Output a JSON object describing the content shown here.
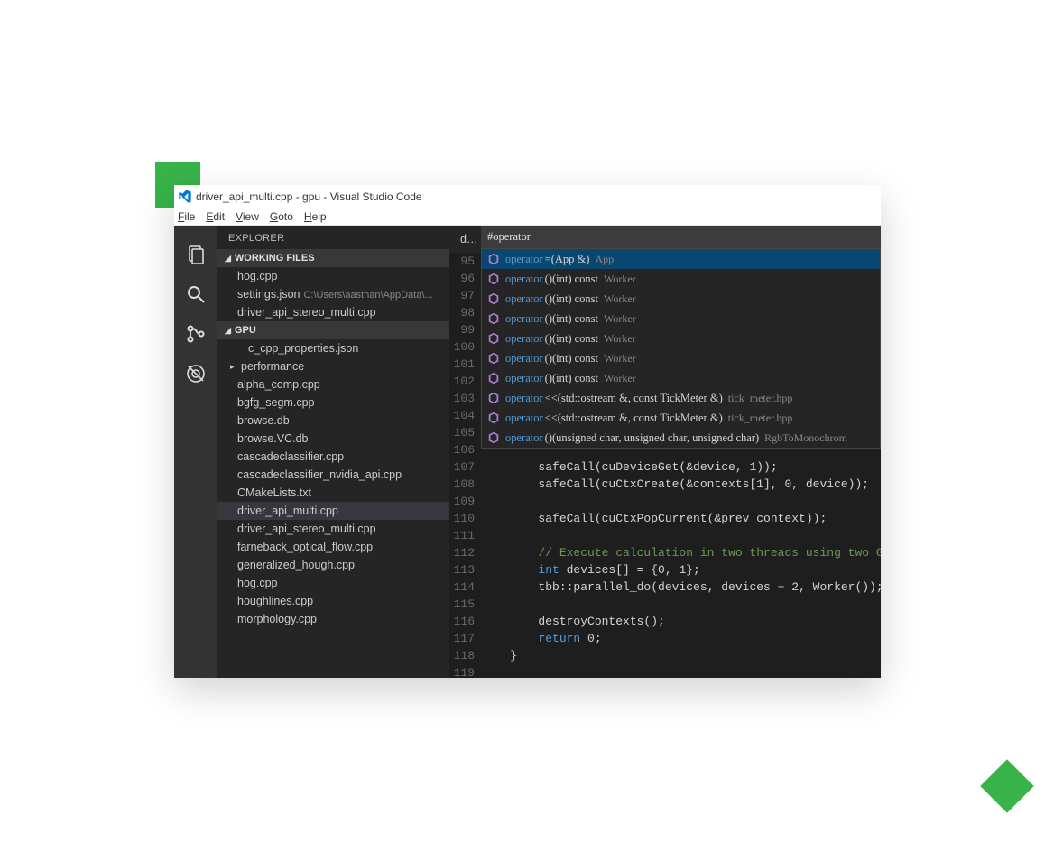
{
  "window": {
    "title": "driver_api_multi.cpp - gpu - Visual Studio Code"
  },
  "menu": {
    "file": "File",
    "edit": "Edit",
    "view": "View",
    "goto": "Goto",
    "help": "Help"
  },
  "sidebar": {
    "title": "EXPLORER",
    "working_header": "WORKING FILES",
    "working": [
      {
        "name": "hog.cpp"
      },
      {
        "name": "settings.json",
        "dim": "C:\\Users\\aasthan\\AppData\\..."
      },
      {
        "name": "driver_api_stereo_multi.cpp"
      }
    ],
    "project_header": "GPU",
    "files": [
      {
        "name": "c_cpp_properties.json",
        "indent": true
      },
      {
        "name": "performance",
        "tw": "▸"
      },
      {
        "name": "alpha_comp.cpp"
      },
      {
        "name": "bgfg_segm.cpp"
      },
      {
        "name": "browse.db"
      },
      {
        "name": "browse.VC.db"
      },
      {
        "name": "cascadeclassifier.cpp"
      },
      {
        "name": "cascadeclassifier_nvidia_api.cpp"
      },
      {
        "name": "CMakeLists.txt"
      },
      {
        "name": "driver_api_multi.cpp",
        "selected": true
      },
      {
        "name": "driver_api_stereo_multi.cpp"
      },
      {
        "name": "farneback_optical_flow.cpp"
      },
      {
        "name": "generalized_hough.cpp"
      },
      {
        "name": "hog.cpp"
      },
      {
        "name": "houghlines.cpp"
      },
      {
        "name": "morphology.cpp"
      }
    ]
  },
  "tabs": {
    "tab0": "dr"
  },
  "search": {
    "value": "#operator"
  },
  "suggest": [
    {
      "name": "operator",
      "sig": "=(App &)",
      "hint": "App",
      "selected": true
    },
    {
      "name": "operator",
      "sig": "()(int) const",
      "hint": "Worker"
    },
    {
      "name": "operator",
      "sig": "()(int) const",
      "hint": "Worker"
    },
    {
      "name": "operator",
      "sig": "()(int) const",
      "hint": "Worker"
    },
    {
      "name": "operator",
      "sig": "()(int) const",
      "hint": "Worker"
    },
    {
      "name": "operator",
      "sig": "()(int) const",
      "hint": "Worker"
    },
    {
      "name": "operator",
      "sig": "()(int) const",
      "hint": "Worker"
    },
    {
      "name": "operator",
      "sig": "<<(std::ostream &, const TickMeter &)",
      "hint": "tick_meter.hpp"
    },
    {
      "name": "operator",
      "sig": "<<(std::ostream &, const TickMeter &)",
      "hint": "tick_meter.hpp"
    },
    {
      "name": "operator",
      "sig": "()(unsigned char, unsigned char, unsigned char)",
      "hint": "RgbToMonochrom"
    }
  ],
  "code": {
    "startLine": 95,
    "lines": [
      "",
      "",
      "",
      "",
      "",
      "",
      "",
      "",
      "",
      "",
      "",
      "",
      {
        "plain": "        safeCall(cuDeviceGet(&device, 1));"
      },
      {
        "plain": "        safeCall(cuCtxCreate(&contexts[1], 0, device));"
      },
      {
        "plain": ""
      },
      {
        "plain": "        safeCall(cuCtxPopCurrent(&prev_context));"
      },
      {
        "plain": ""
      },
      {
        "comment": "        // Execute calculation in two threads using two GPU"
      },
      {
        "kw": "int",
        "rest": " devices[] = {0, 1};",
        "lead": "        "
      },
      {
        "plain": "        tbb::parallel_do(devices, devices + 2, Worker());"
      },
      {
        "plain": ""
      },
      {
        "plain": "        destroyContexts();"
      },
      {
        "kw": "return",
        "rest": " 0;",
        "lead": "        "
      },
      {
        "plain": "    }"
      },
      {
        "plain": ""
      }
    ]
  }
}
